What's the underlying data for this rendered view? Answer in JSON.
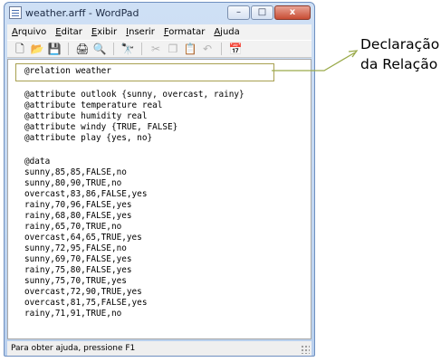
{
  "window": {
    "title": "weather.arff - WordPad",
    "buttons": {
      "minimize": "–",
      "maximize": "□",
      "close": "x"
    }
  },
  "menu": [
    "Arquivo",
    "Editar",
    "Exibir",
    "Inserir",
    "Formatar",
    "Ajuda"
  ],
  "toolbar": {
    "icons": [
      "new-icon",
      "open-icon",
      "save-icon",
      "print-icon",
      "print-preview-icon",
      "find-icon",
      "cut-icon",
      "copy-icon",
      "paste-icon",
      "undo-icon",
      "date-time-icon"
    ],
    "glyphs": {
      "new": "🗋",
      "open": "📂",
      "save": "💾",
      "print": "🖨",
      "preview": "🔍",
      "find": "🔭",
      "cut": "✂",
      "copy": "❐",
      "paste": "📋",
      "undo": "↶",
      "datetime": "📅"
    }
  },
  "document": {
    "lines": [
      "@relation weather",
      "",
      "@attribute outlook {sunny, overcast, rainy}",
      "@attribute temperature real",
      "@attribute humidity real",
      "@attribute windy {TRUE, FALSE}",
      "@attribute play {yes, no}",
      "",
      "@data",
      "sunny,85,85,FALSE,no",
      "sunny,80,90,TRUE,no",
      "overcast,83,86,FALSE,yes",
      "rainy,70,96,FALSE,yes",
      "rainy,68,80,FALSE,yes",
      "rainy,65,70,TRUE,no",
      "overcast,64,65,TRUE,yes",
      "sunny,72,95,FALSE,no",
      "sunny,69,70,FALSE,yes",
      "rainy,75,80,FALSE,yes",
      "sunny,75,70,TRUE,yes",
      "overcast,72,90,TRUE,yes",
      "overcast,81,75,FALSE,yes",
      "rainy,71,91,TRUE,no"
    ]
  },
  "status": {
    "text": "Para obter ajuda, pressione F1"
  },
  "annotation": {
    "line1": "Declaração",
    "line2": "da Relação",
    "color": "#9aaa4a"
  },
  "colors": {
    "titlebar": "#c4d8f2",
    "close_button": "#c84c33",
    "highlight_border": "#a8a050"
  }
}
